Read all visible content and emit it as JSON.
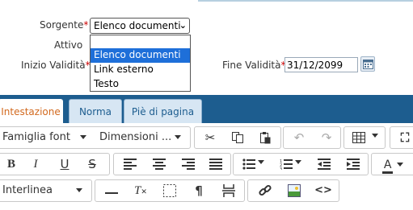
{
  "form": {
    "sorgente_label": "Sorgente",
    "required_mark": "*",
    "sorgente_value": "Elenco documenti",
    "attivo_label": "Attivo",
    "inizio_label": "Inizio Validità",
    "fine_label": "Fine Validità",
    "fine_value": "31/12/2099",
    "options": [
      "Elenco documenti",
      "Link esterno",
      "Testo"
    ]
  },
  "tabs": [
    "Intestazione",
    "Norma",
    "Piè di pagina"
  ],
  "toolbar": {
    "font_family": "Famiglia font",
    "font_size": "Dimensioni ...",
    "line_height": "Interlinea",
    "text_color_letter": "A"
  },
  "icons": [
    "calendar-icon",
    "cut-icon",
    "copy-icon",
    "paste-icon",
    "undo-icon",
    "redo-icon",
    "table-icon",
    "fullscreen-icon",
    "bold-icon",
    "italic-icon",
    "underline-icon",
    "strikethrough-icon",
    "align-left-icon",
    "align-center-icon",
    "align-right-icon",
    "align-justify-icon",
    "bullet-list-icon",
    "numbered-list-icon",
    "outdent-icon",
    "indent-icon",
    "text-color-icon",
    "horizontal-rule-icon",
    "clear-format-icon",
    "show-blocks-icon",
    "paragraph-icon",
    "page-break-icon",
    "link-icon",
    "image-icon",
    "code-icon"
  ]
}
